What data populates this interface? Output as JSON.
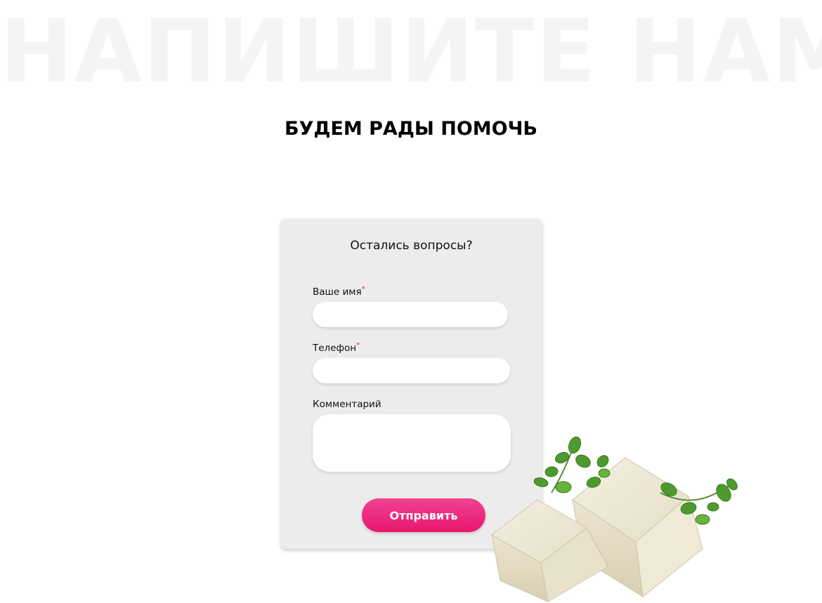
{
  "background_heading": "НАПИШИТЕ НАМ",
  "subtitle": "БУДЕМ РАДЫ ПОМОЧЬ",
  "form": {
    "title": "Остались вопросы?",
    "fields": {
      "name": {
        "label": "Ваше имя",
        "required_mark": "*",
        "value": ""
      },
      "phone": {
        "label": "Телефон",
        "required_mark": "*",
        "value": ""
      },
      "comment": {
        "label": "Комментарий",
        "value": ""
      }
    },
    "submit_label": "Отправить"
  },
  "colors": {
    "accent": "#e8166b",
    "accent_light": "#f24394",
    "card_background": "#ececec",
    "background_heading": "#f4f4f4",
    "required_mark": "#e81a6d"
  },
  "decor": {
    "image": "tofu-with-herbs-icon"
  }
}
